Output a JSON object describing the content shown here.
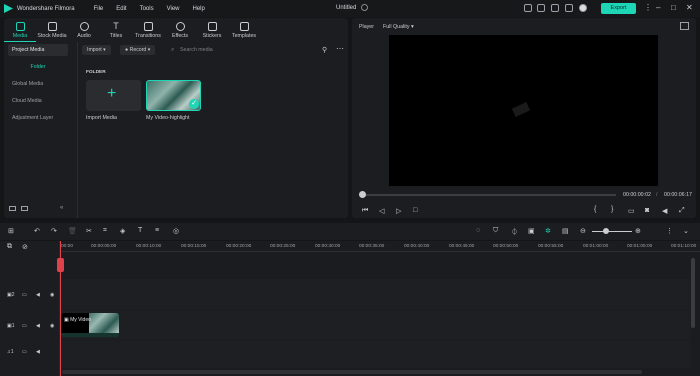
{
  "app": {
    "name": "Wondershare Filmora",
    "project_title": "Untitled",
    "export_label": "Export",
    "menu": [
      "File",
      "Edit",
      "Tools",
      "View",
      "Help"
    ]
  },
  "tabs": [
    {
      "label": "Media"
    },
    {
      "label": "Stock Media"
    },
    {
      "label": "Audio"
    },
    {
      "label": "Titles"
    },
    {
      "label": "Transitions"
    },
    {
      "label": "Effects"
    },
    {
      "label": "Stickers"
    },
    {
      "label": "Templates"
    }
  ],
  "sidebar": {
    "items": [
      {
        "label": "Project Media"
      },
      {
        "label": "Folder"
      },
      {
        "label": "Global Media"
      },
      {
        "label": "Cloud Media"
      },
      {
        "label": "Adjustment Layer"
      }
    ]
  },
  "media": {
    "import_label": "Import",
    "record_label": "Record",
    "search_placeholder": "Search media",
    "folder_header": "FOLDER",
    "cards": [
      {
        "label": "Import Media"
      },
      {
        "label": "My Video-highlight"
      }
    ]
  },
  "player": {
    "label": "Player",
    "quality": "Full Quality",
    "current_time": "00:00:00:02",
    "total_time": "00:00:06:17"
  },
  "timeline": {
    "ticks": [
      "00:00",
      "00:00:05:00",
      "00:00:10:00",
      "00:00:15:00",
      "00:00:20:00",
      "00:00:25:00",
      "00:00:30:00",
      "00:00:35:00",
      "00:00:40:00",
      "00:00:45:00",
      "00:00:50:00",
      "00:00:55:00",
      "00:01:00:00",
      "00:01:05:00",
      "00:01:10:00"
    ],
    "clip_label": "My Video",
    "track_numbers": [
      "2",
      "1",
      "1"
    ]
  },
  "colors": {
    "accent": "#1ed6b6",
    "playhead": "#e0424d"
  }
}
